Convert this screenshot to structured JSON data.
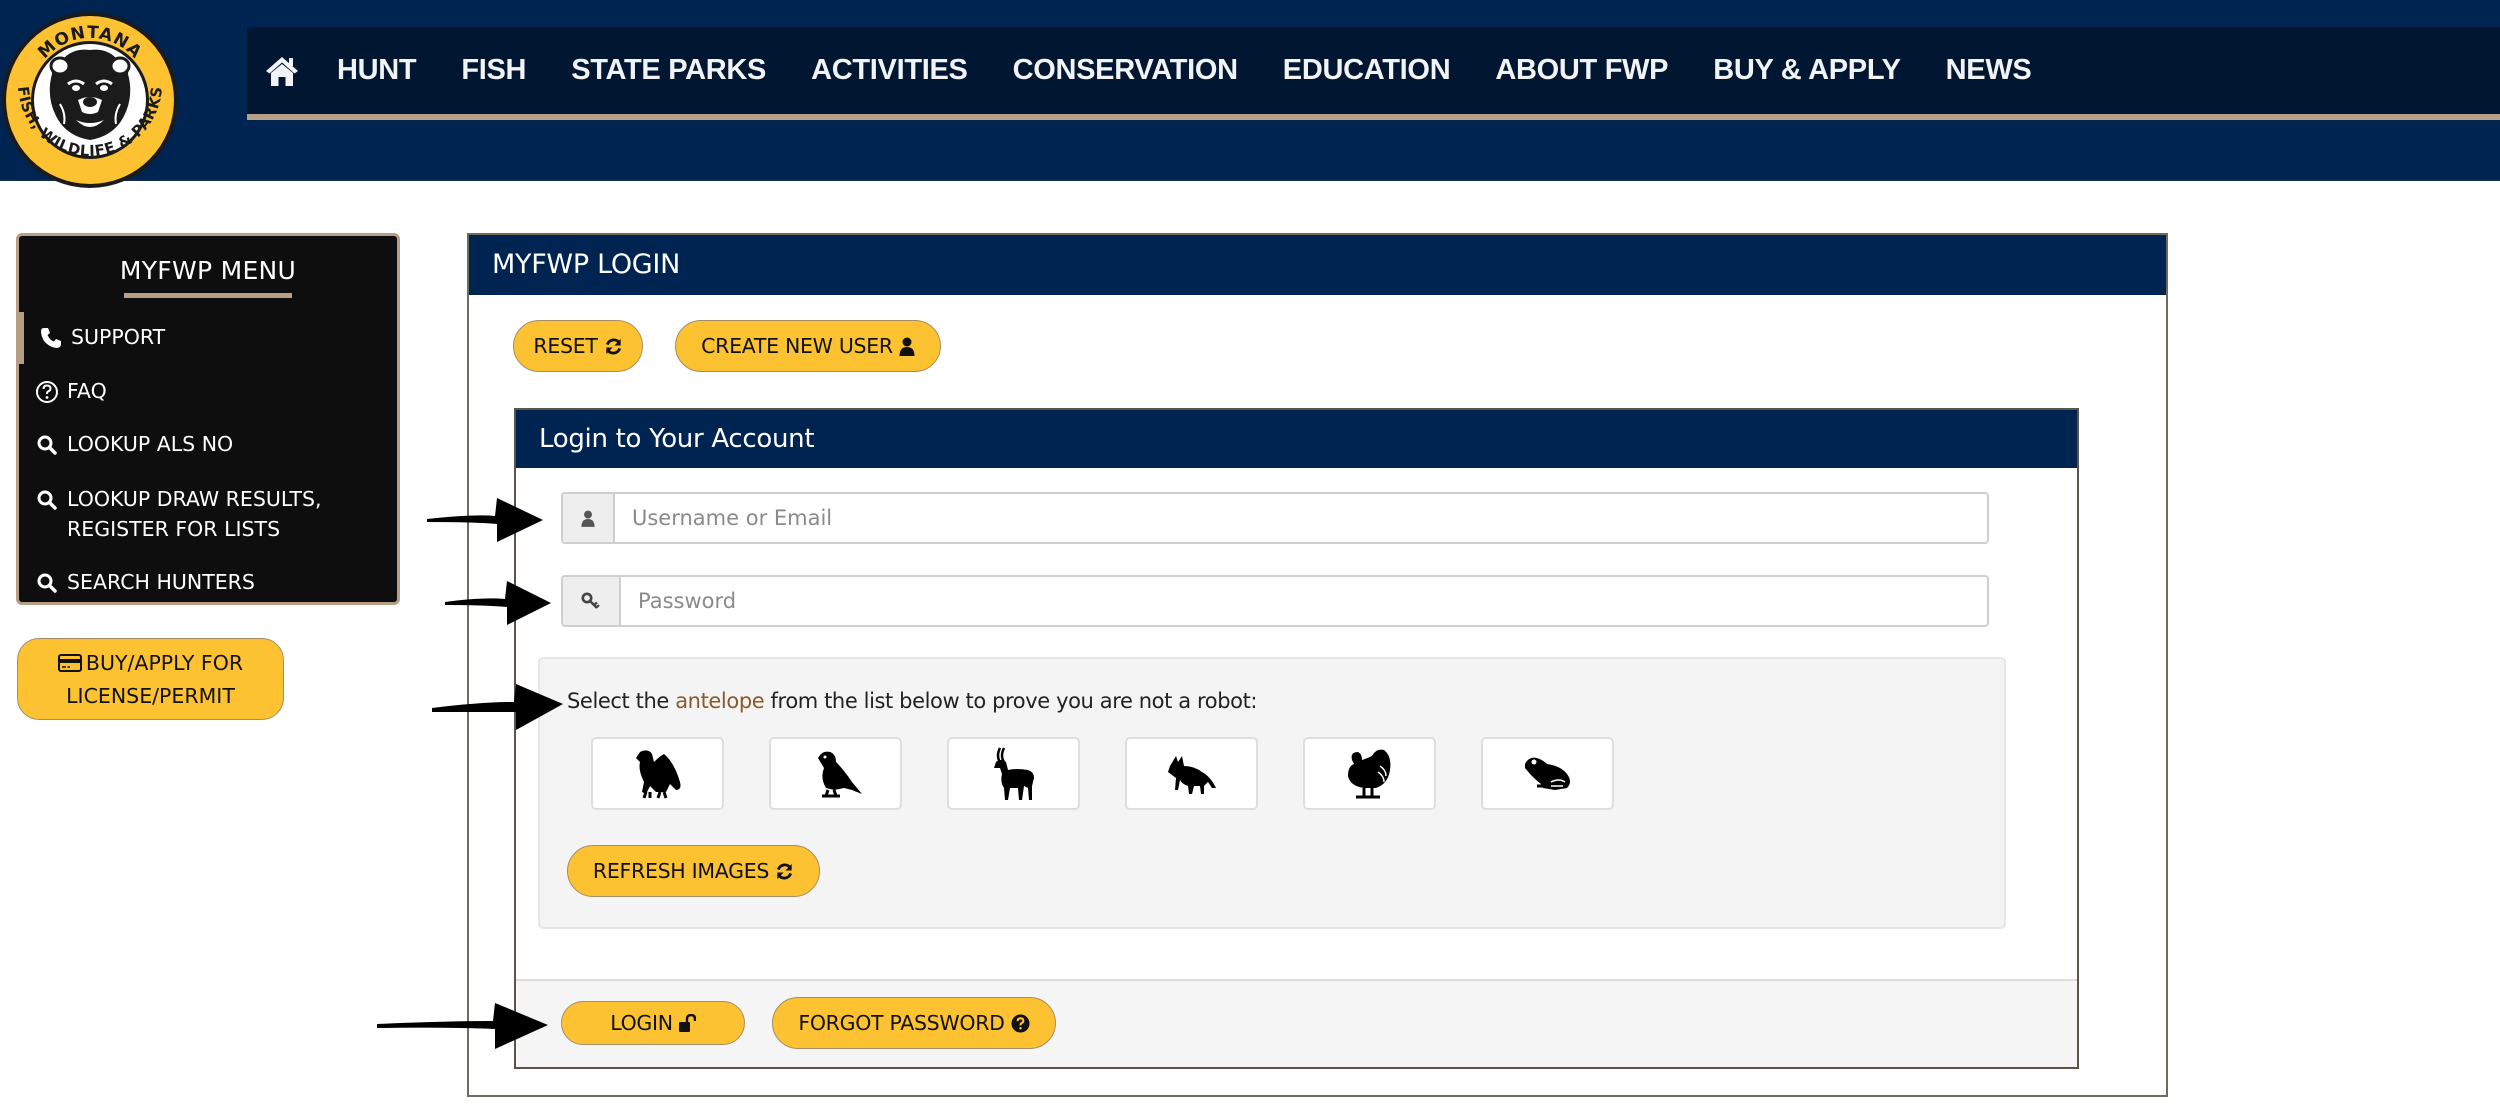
{
  "logo": {
    "top_text": "MONTANA",
    "bottom_text": "FISH, WILDLIFE & PARKS"
  },
  "nav": {
    "home_icon": "home-icon",
    "items": [
      "HUNT",
      "FISH",
      "STATE PARKS",
      "ACTIVITIES",
      "CONSERVATION",
      "EDUCATION",
      "ABOUT FWP",
      "BUY & APPLY",
      "NEWS"
    ]
  },
  "sidebar": {
    "title": "MYFWP MENU",
    "items": [
      {
        "label": "SUPPORT",
        "icon": "phone-icon",
        "active": true
      },
      {
        "label": "FAQ",
        "icon": "question-circle-icon"
      },
      {
        "label": "LOOKUP ALS NO",
        "icon": "search-icon"
      },
      {
        "label": "LOOKUP DRAW RESULTS,",
        "label2": "REGISTER FOR LISTS",
        "icon": "search-icon"
      },
      {
        "label": "SEARCH HUNTERS",
        "icon": "search-icon"
      }
    ],
    "buy_button": {
      "line1": "BUY/APPLY FOR",
      "line2": "LICENSE/PERMIT",
      "icon": "credit-card-icon"
    }
  },
  "panel": {
    "title": "MYFWP LOGIN",
    "reset_label": "RESET",
    "create_user_label": "CREATE NEW USER"
  },
  "login_card": {
    "title": "Login to Your Account",
    "username": {
      "placeholder": "Username or Email",
      "value": ""
    },
    "password": {
      "placeholder": "Password",
      "value": ""
    },
    "captcha": {
      "prefix": "Select the ",
      "target": "antelope",
      "suffix": " from the list below to prove you are not a robot:",
      "options": [
        "eagle",
        "falcon",
        "antelope",
        "fox",
        "turkey",
        "frog"
      ],
      "refresh_label": "REFRESH IMAGES"
    },
    "login_label": "LOGIN",
    "forgot_label": "FORGOT PASSWORD"
  },
  "colors": {
    "navy": "#002452",
    "nav_dark": "#001631",
    "tan": "#b79f86",
    "gold": "#fdc231",
    "sidebar_bg": "#0e0e0e",
    "highlight": "#8a5a2b"
  }
}
